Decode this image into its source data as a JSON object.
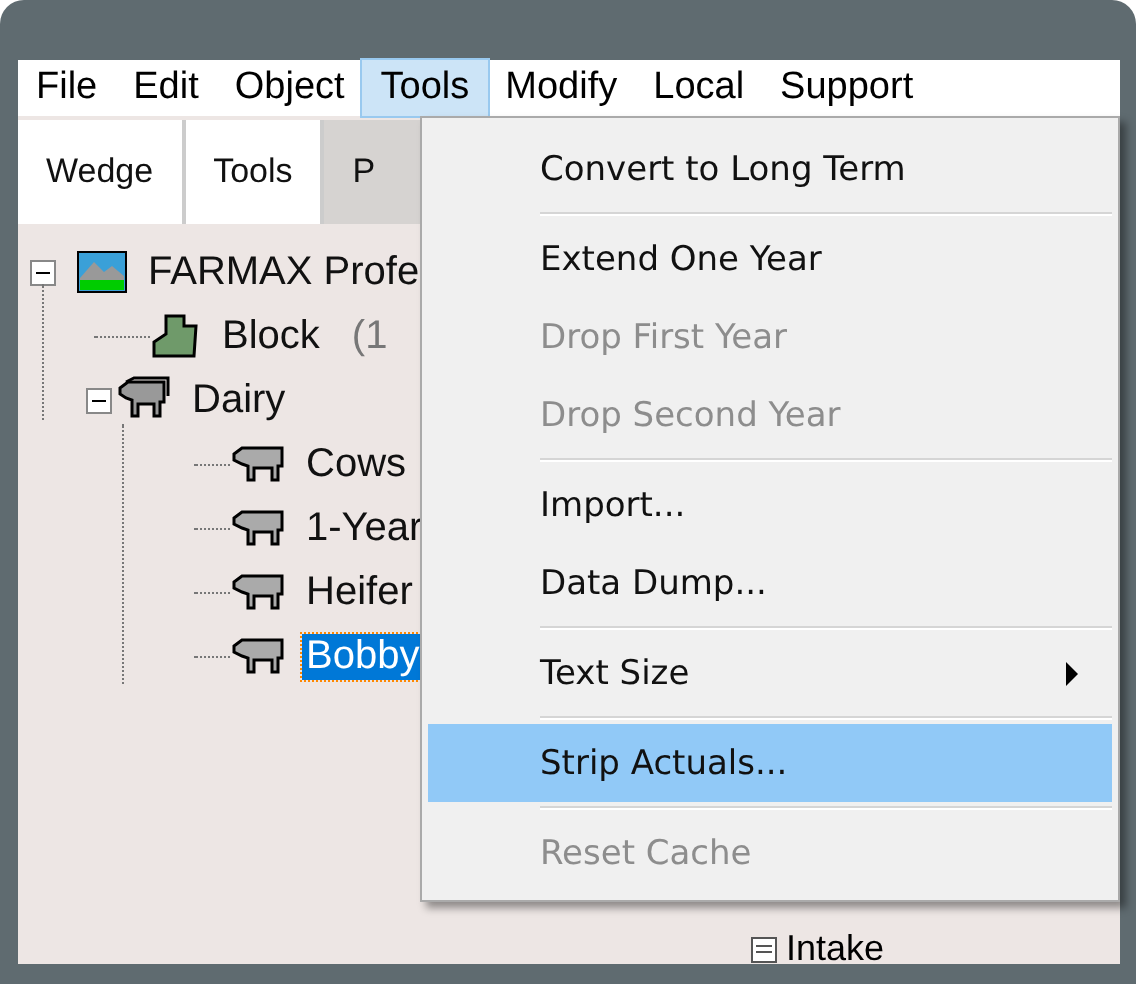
{
  "menu_bar": [
    {
      "label": "File",
      "selected": false
    },
    {
      "label": "Edit",
      "selected": false
    },
    {
      "label": "Object",
      "selected": false
    },
    {
      "label": "Tools",
      "selected": true
    },
    {
      "label": "Modify",
      "selected": false
    },
    {
      "label": "Local",
      "selected": false
    },
    {
      "label": "Support",
      "selected": false
    }
  ],
  "tabs": [
    {
      "label": "Wedge",
      "selected": false
    },
    {
      "label": "Tools",
      "selected": false
    },
    {
      "label": "P",
      "selected": true
    }
  ],
  "tree": [
    {
      "label": "FARMAX Profe",
      "kind": "farm",
      "expanded": true,
      "selected": false,
      "children": [
        {
          "label": "Block",
          "kind": "block",
          "note": "(1",
          "selected": false
        },
        {
          "label": "Dairy",
          "kind": "herd",
          "expanded": true,
          "selected": false,
          "children": [
            {
              "label": "Cows",
              "kind": "cow",
              "selected": false
            },
            {
              "label": "1-Year",
              "kind": "cow",
              "selected": false
            },
            {
              "label": "Heifer",
              "kind": "cow",
              "selected": false
            },
            {
              "label": "Bobby",
              "kind": "cow",
              "selected": true
            }
          ]
        }
      ]
    }
  ],
  "hidden_item": {
    "label": "Intake"
  },
  "tools_menu": [
    [
      {
        "label": "Convert to Long Term",
        "disabled": false,
        "selected": false,
        "submenu": false
      }
    ],
    [
      {
        "label": "Extend One Year",
        "disabled": false,
        "selected": false,
        "submenu": false
      },
      {
        "label": "Drop First Year",
        "disabled": true,
        "selected": false,
        "submenu": false
      },
      {
        "label": "Drop Second Year",
        "disabled": true,
        "selected": false,
        "submenu": false
      }
    ],
    [
      {
        "label": "Import...",
        "disabled": false,
        "selected": false,
        "submenu": false
      },
      {
        "label": "Data Dump...",
        "disabled": false,
        "selected": false,
        "submenu": false
      }
    ],
    [
      {
        "label": "Text Size",
        "disabled": false,
        "selected": false,
        "submenu": true
      }
    ],
    [
      {
        "label": "Strip Actuals...",
        "disabled": false,
        "selected": true,
        "submenu": false
      }
    ],
    [
      {
        "label": "Reset Cache",
        "disabled": true,
        "selected": false,
        "submenu": false
      }
    ]
  ]
}
